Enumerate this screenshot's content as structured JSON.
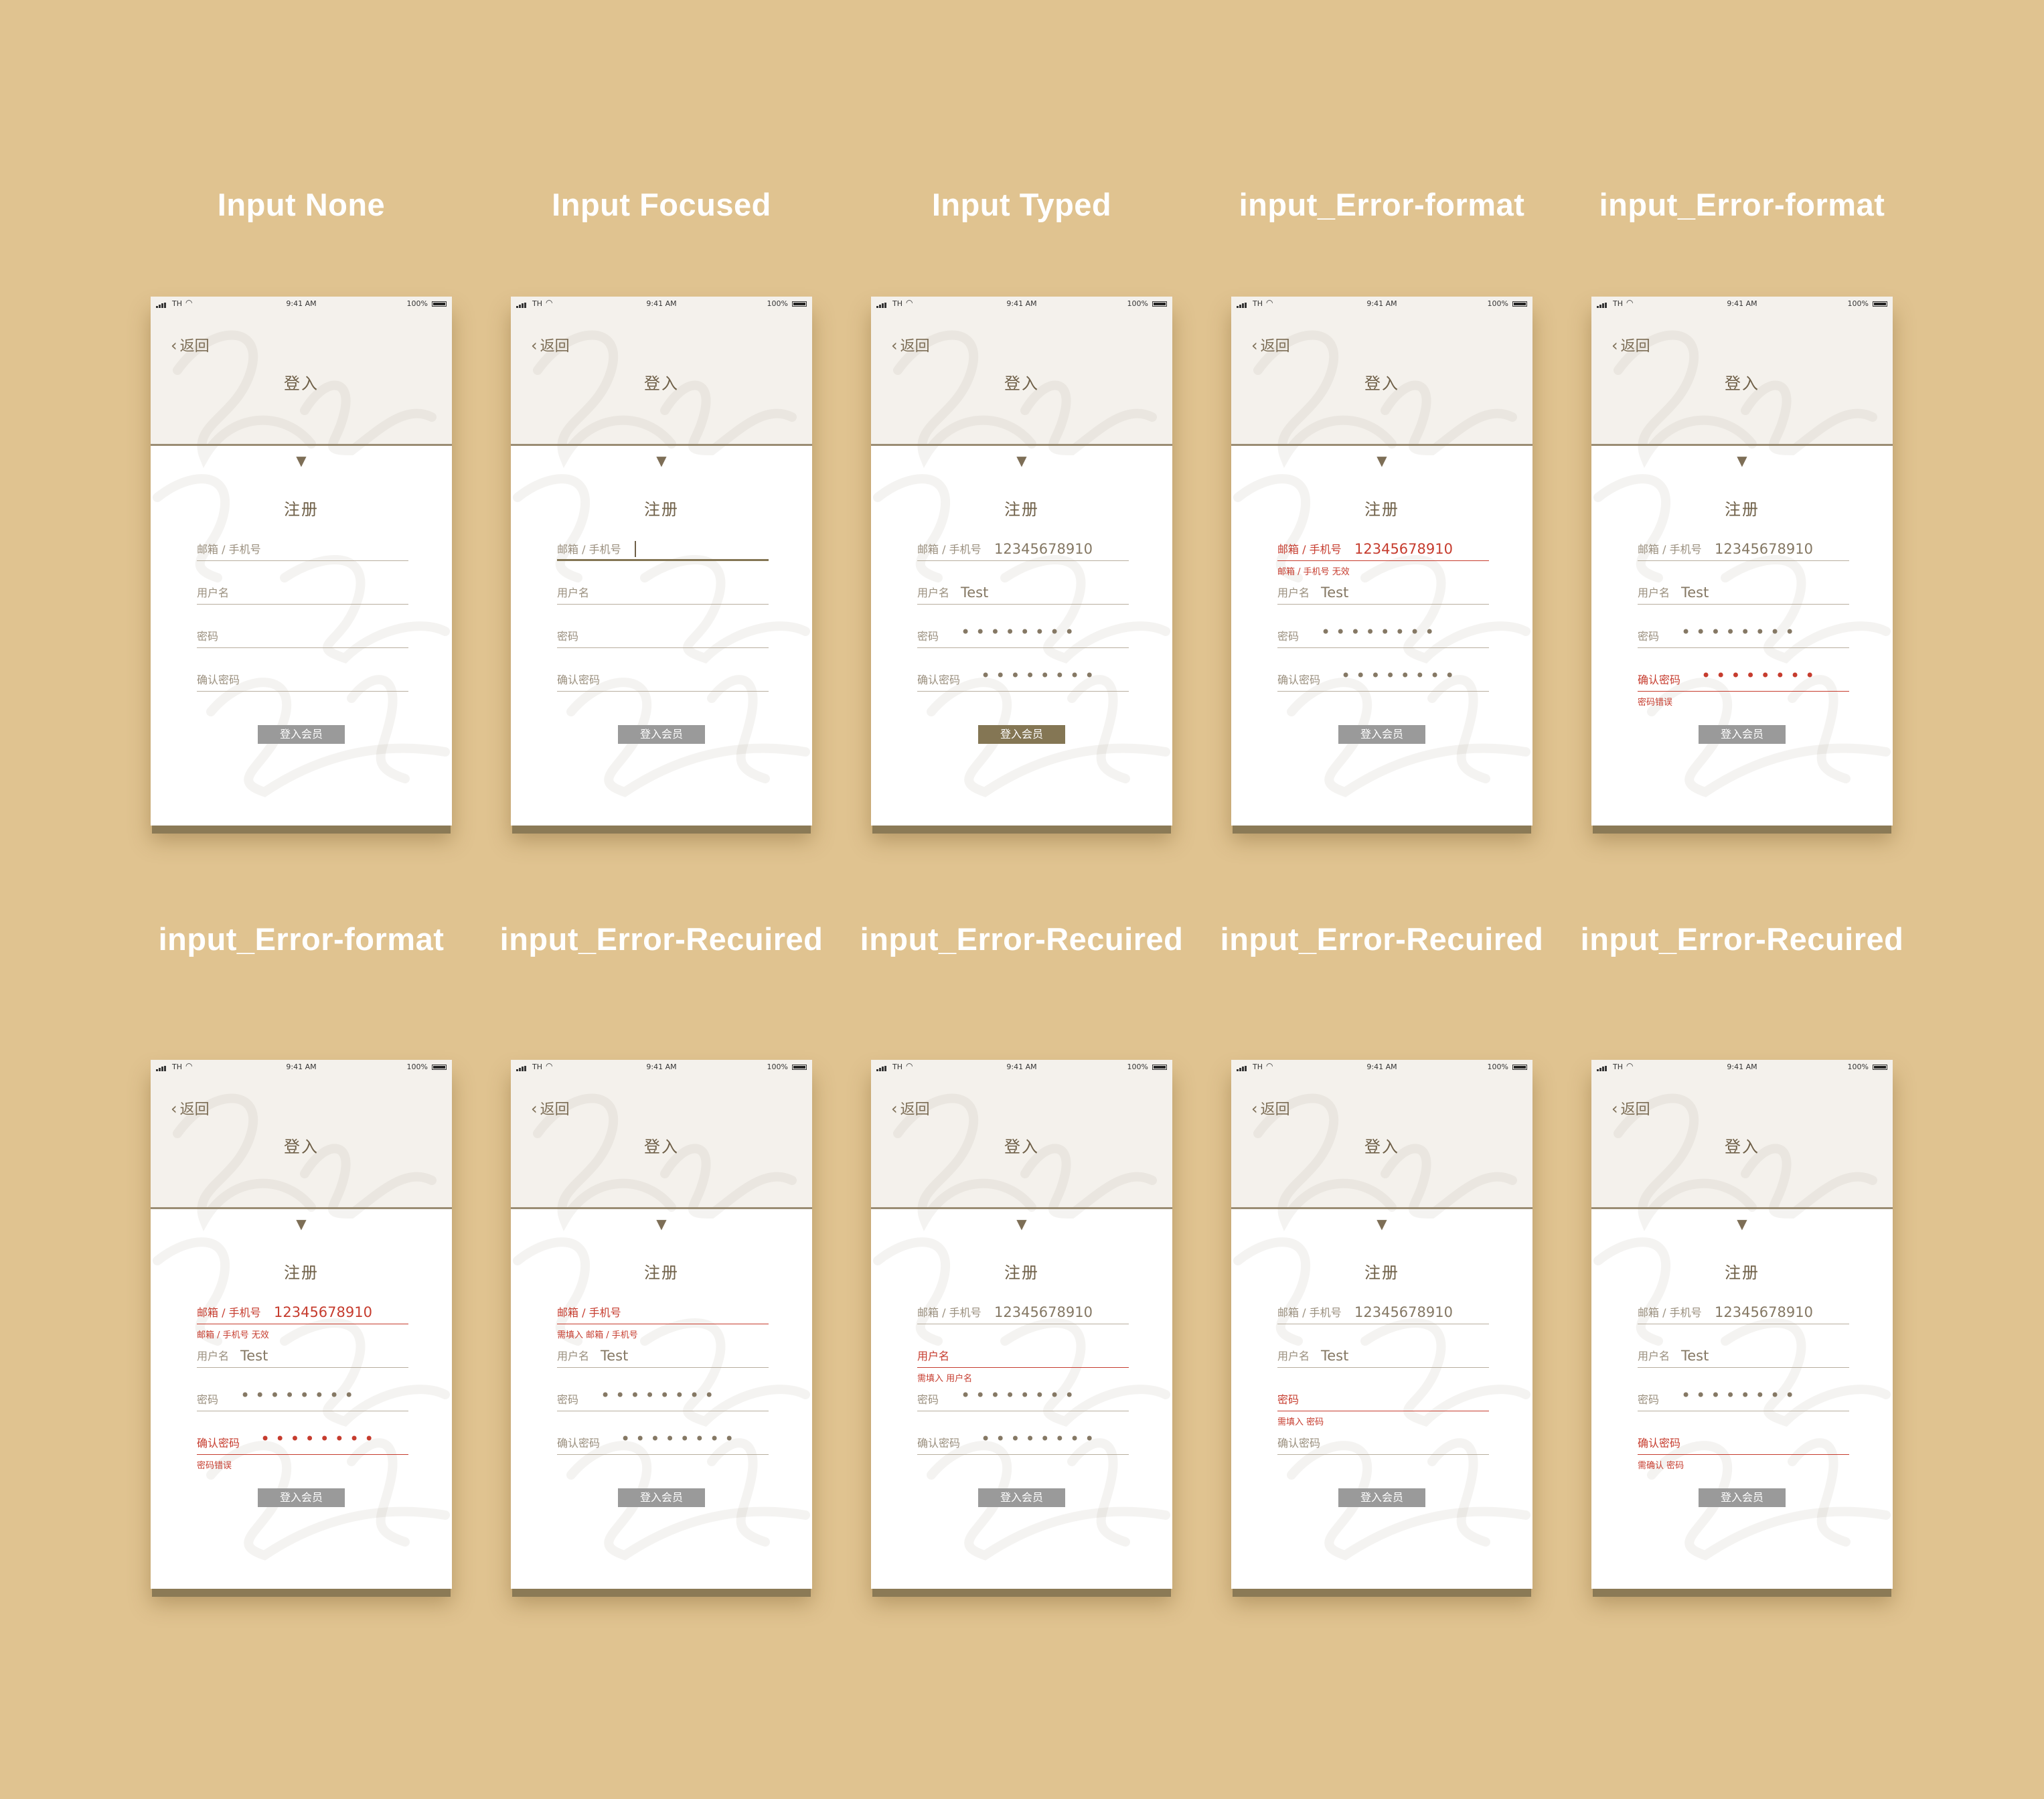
{
  "colors": {
    "background": "#e0c390",
    "header": "#f4f1ec",
    "accent": "#847654",
    "error": "#c63c2e",
    "button_disabled": "#9a9a9a"
  },
  "screens": [
    {
      "caption": "Input None",
      "state": "none",
      "button_active": false,
      "status": {
        "carrier": "TH",
        "time": "9:41 AM",
        "battery": "100%"
      },
      "back_label": "返回",
      "title": "登入",
      "register_label": "注册",
      "button_label": "登入会员",
      "fields": [
        {
          "label": "邮箱 / 手机号",
          "value": "",
          "masked": false,
          "error": false,
          "focused": false,
          "error_text": ""
        },
        {
          "label": "用户名",
          "value": "",
          "masked": false,
          "error": false,
          "focused": false,
          "error_text": ""
        },
        {
          "label": "密码",
          "value": "",
          "masked": false,
          "error": false,
          "focused": false,
          "error_text": ""
        },
        {
          "label": "确认密码",
          "value": "",
          "masked": false,
          "error": false,
          "focused": false,
          "error_text": ""
        }
      ]
    },
    {
      "caption": "Input Focused",
      "state": "focused",
      "button_active": false,
      "status": {
        "carrier": "TH",
        "time": "9:41 AM",
        "battery": "100%"
      },
      "back_label": "返回",
      "title": "登入",
      "register_label": "注册",
      "button_label": "登入会员",
      "fields": [
        {
          "label": "邮箱 / 手机号",
          "value": "",
          "masked": false,
          "error": false,
          "focused": true,
          "error_text": ""
        },
        {
          "label": "用户名",
          "value": "",
          "masked": false,
          "error": false,
          "focused": false,
          "error_text": ""
        },
        {
          "label": "密码",
          "value": "",
          "masked": false,
          "error": false,
          "focused": false,
          "error_text": ""
        },
        {
          "label": "确认密码",
          "value": "",
          "masked": false,
          "error": false,
          "focused": false,
          "error_text": ""
        }
      ]
    },
    {
      "caption": "Input Typed",
      "state": "typed",
      "button_active": true,
      "status": {
        "carrier": "TH",
        "time": "9:41 AM",
        "battery": "100%"
      },
      "back_label": "返回",
      "title": "登入",
      "register_label": "注册",
      "button_label": "登入会员",
      "fields": [
        {
          "label": "邮箱 / 手机号",
          "value": "12345678910",
          "masked": false,
          "error": false,
          "focused": false,
          "error_text": ""
        },
        {
          "label": "用户名",
          "value": "Test",
          "masked": false,
          "error": false,
          "focused": false,
          "error_text": ""
        },
        {
          "label": "密码",
          "value": "••••••••",
          "masked": true,
          "error": false,
          "focused": false,
          "error_text": ""
        },
        {
          "label": "确认密码",
          "value": "••••••••",
          "masked": true,
          "error": false,
          "focused": false,
          "error_text": ""
        }
      ]
    },
    {
      "caption": "input_Error-format",
      "state": "error-format",
      "button_active": false,
      "status": {
        "carrier": "TH",
        "time": "9:41 AM",
        "battery": "100%"
      },
      "back_label": "返回",
      "title": "登入",
      "register_label": "注册",
      "button_label": "登入会员",
      "fields": [
        {
          "label": "邮箱 / 手机号",
          "value": "12345678910",
          "masked": false,
          "error": true,
          "focused": false,
          "error_text": "邮箱 / 手机号 无效"
        },
        {
          "label": "用户名",
          "value": "Test",
          "masked": false,
          "error": false,
          "focused": false,
          "error_text": ""
        },
        {
          "label": "密码",
          "value": "••••••••",
          "masked": true,
          "error": false,
          "focused": false,
          "error_text": ""
        },
        {
          "label": "确认密码",
          "value": "••••••••",
          "masked": true,
          "error": false,
          "focused": false,
          "error_text": ""
        }
      ]
    },
    {
      "caption": "input_Error-format",
      "state": "error-format",
      "button_active": false,
      "status": {
        "carrier": "TH",
        "time": "9:41 AM",
        "battery": "100%"
      },
      "back_label": "返回",
      "title": "登入",
      "register_label": "注册",
      "button_label": "登入会员",
      "fields": [
        {
          "label": "邮箱 / 手机号",
          "value": "12345678910",
          "masked": false,
          "error": false,
          "focused": false,
          "error_text": ""
        },
        {
          "label": "用户名",
          "value": "Test",
          "masked": false,
          "error": false,
          "focused": false,
          "error_text": ""
        },
        {
          "label": "密码",
          "value": "••••••••",
          "masked": true,
          "error": false,
          "focused": false,
          "error_text": ""
        },
        {
          "label": "确认密码",
          "value": "••••••••",
          "masked": true,
          "error": true,
          "focused": false,
          "error_text": "密码错误"
        }
      ]
    },
    {
      "caption": "input_Error-format",
      "state": "error-format",
      "button_active": false,
      "status": {
        "carrier": "TH",
        "time": "9:41 AM",
        "battery": "100%"
      },
      "back_label": "返回",
      "title": "登入",
      "register_label": "注册",
      "button_label": "登入会员",
      "fields": [
        {
          "label": "邮箱 / 手机号",
          "value": "12345678910",
          "masked": false,
          "error": true,
          "focused": false,
          "error_text": "邮箱 / 手机号 无效"
        },
        {
          "label": "用户名",
          "value": "Test",
          "masked": false,
          "error": false,
          "focused": false,
          "error_text": ""
        },
        {
          "label": "密码",
          "value": "••••••••",
          "masked": true,
          "error": false,
          "focused": false,
          "error_text": ""
        },
        {
          "label": "确认密码",
          "value": "••••••••",
          "masked": true,
          "error": true,
          "focused": false,
          "error_text": "密码错误"
        }
      ]
    },
    {
      "caption": "input_Error-Recuired",
      "state": "error-required",
      "button_active": false,
      "status": {
        "carrier": "TH",
        "time": "9:41 AM",
        "battery": "100%"
      },
      "back_label": "返回",
      "title": "登入",
      "register_label": "注册",
      "button_label": "登入会员",
      "fields": [
        {
          "label": "邮箱 / 手机号",
          "value": "",
          "masked": false,
          "error": true,
          "focused": false,
          "error_text": "需填入 邮箱 / 手机号"
        },
        {
          "label": "用户名",
          "value": "Test",
          "masked": false,
          "error": false,
          "focused": false,
          "error_text": ""
        },
        {
          "label": "密码",
          "value": "••••••••",
          "masked": true,
          "error": false,
          "focused": false,
          "error_text": ""
        },
        {
          "label": "确认密码",
          "value": "••••••••",
          "masked": true,
          "error": false,
          "focused": false,
          "error_text": ""
        }
      ]
    },
    {
      "caption": "input_Error-Recuired",
      "state": "error-required",
      "button_active": false,
      "status": {
        "carrier": "TH",
        "time": "9:41 AM",
        "battery": "100%"
      },
      "back_label": "返回",
      "title": "登入",
      "register_label": "注册",
      "button_label": "登入会员",
      "fields": [
        {
          "label": "邮箱 / 手机号",
          "value": "12345678910",
          "masked": false,
          "error": false,
          "focused": false,
          "error_text": ""
        },
        {
          "label": "用户名",
          "value": "",
          "masked": false,
          "error": true,
          "focused": false,
          "error_text": "需填入 用户名"
        },
        {
          "label": "密码",
          "value": "••••••••",
          "masked": true,
          "error": false,
          "focused": false,
          "error_text": ""
        },
        {
          "label": "确认密码",
          "value": "••••••••",
          "masked": true,
          "error": false,
          "focused": false,
          "error_text": ""
        }
      ]
    },
    {
      "caption": "input_Error-Recuired",
      "state": "error-required",
      "button_active": false,
      "status": {
        "carrier": "TH",
        "time": "9:41 AM",
        "battery": "100%"
      },
      "back_label": "返回",
      "title": "登入",
      "register_label": "注册",
      "button_label": "登入会员",
      "fields": [
        {
          "label": "邮箱 / 手机号",
          "value": "12345678910",
          "masked": false,
          "error": false,
          "focused": false,
          "error_text": ""
        },
        {
          "label": "用户名",
          "value": "Test",
          "masked": false,
          "error": false,
          "focused": false,
          "error_text": ""
        },
        {
          "label": "密码",
          "value": "",
          "masked": false,
          "error": true,
          "focused": false,
          "error_text": "需填入 密码"
        },
        {
          "label": "确认密码",
          "value": "",
          "masked": false,
          "error": false,
          "focused": false,
          "error_text": ""
        }
      ]
    },
    {
      "caption": "input_Error-Recuired",
      "state": "error-required",
      "button_active": false,
      "status": {
        "carrier": "TH",
        "time": "9:41 AM",
        "battery": "100%"
      },
      "back_label": "返回",
      "title": "登入",
      "register_label": "注册",
      "button_label": "登入会员",
      "fields": [
        {
          "label": "邮箱 / 手机号",
          "value": "12345678910",
          "masked": false,
          "error": false,
          "focused": false,
          "error_text": ""
        },
        {
          "label": "用户名",
          "value": "Test",
          "masked": false,
          "error": false,
          "focused": false,
          "error_text": ""
        },
        {
          "label": "密码",
          "value": "••••••••",
          "masked": true,
          "error": false,
          "focused": false,
          "error_text": ""
        },
        {
          "label": "确认密码",
          "value": "",
          "masked": false,
          "error": true,
          "focused": false,
          "error_text": "需确认 密码"
        }
      ]
    }
  ]
}
